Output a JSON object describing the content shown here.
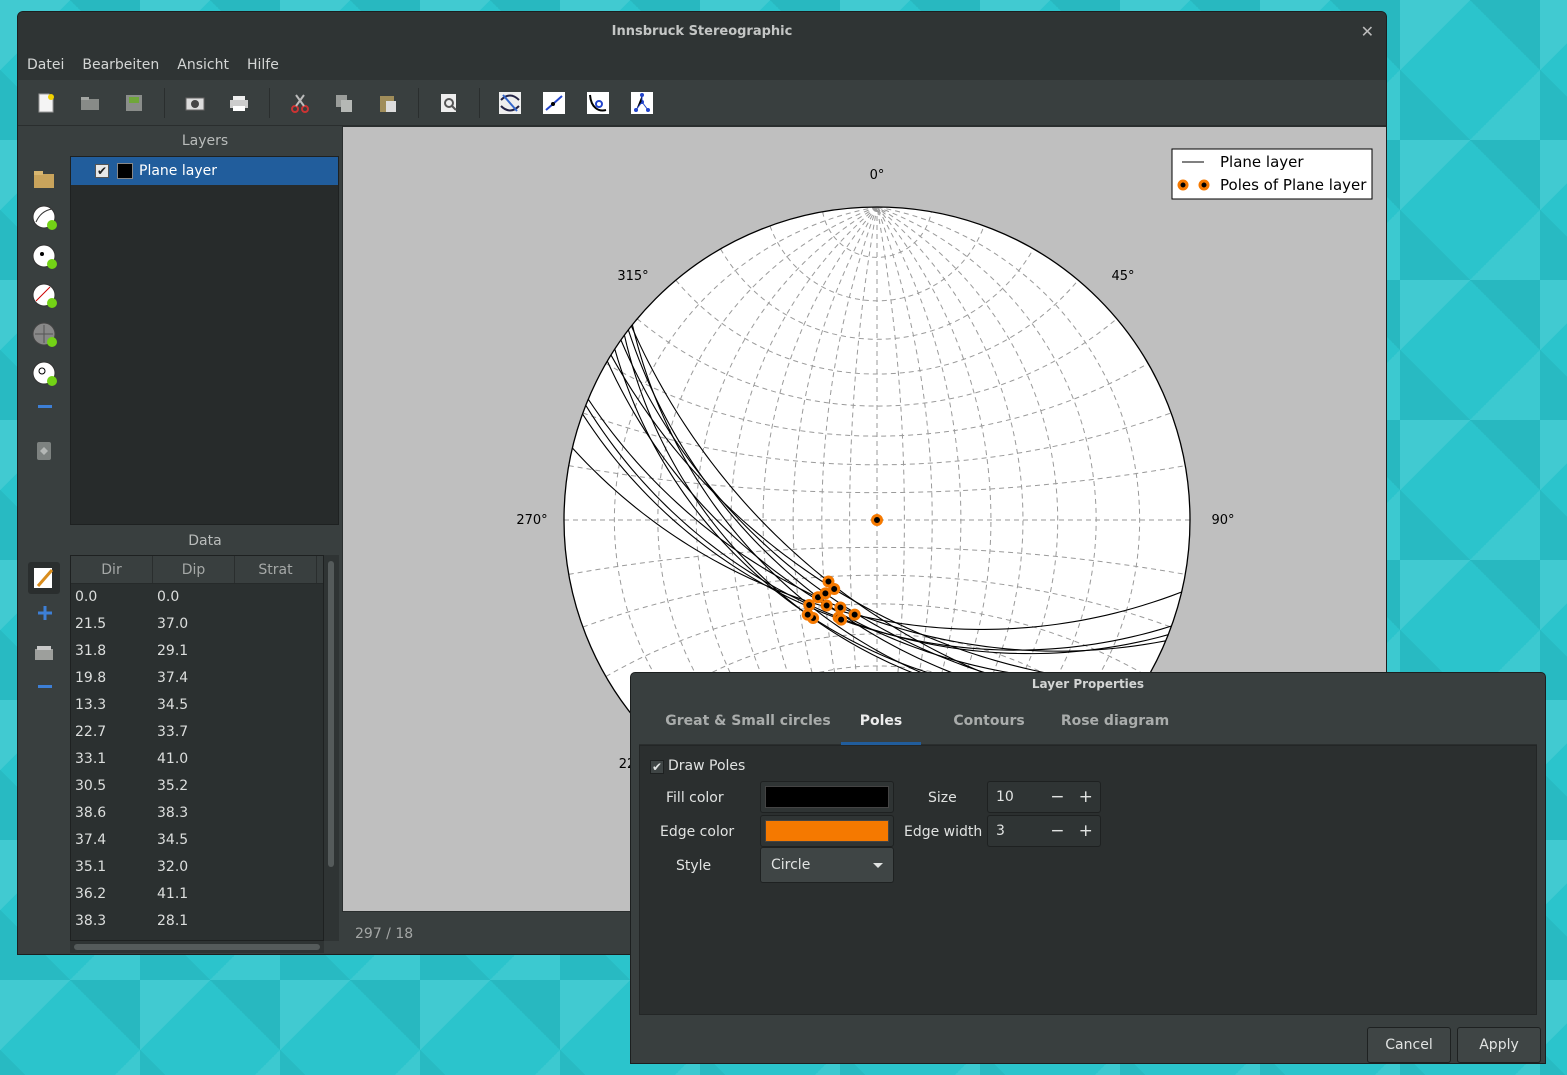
{
  "window": {
    "title": "Innsbruck Stereographic"
  },
  "menu": [
    "Datei",
    "Bearbeiten",
    "Ansicht",
    "Hilfe"
  ],
  "toolbar_icons": [
    "new-file",
    "open",
    "save",
    "screenshot",
    "print",
    "cut",
    "copy",
    "paste",
    "zoom",
    "great-circle",
    "line",
    "small-circle",
    "pole"
  ],
  "panels": {
    "layers_title": "Layers",
    "data_title": "Data"
  },
  "layers": [
    {
      "name": "Plane layer",
      "checked": true,
      "color": "#000000"
    }
  ],
  "data_table": {
    "headers": [
      "Dir",
      "Dip",
      "Strat"
    ],
    "rows": [
      [
        "0.0",
        "0.0",
        ""
      ],
      [
        "21.5",
        "37.0",
        ""
      ],
      [
        "31.8",
        "29.1",
        ""
      ],
      [
        "19.8",
        "37.4",
        ""
      ],
      [
        "13.3",
        "34.5",
        ""
      ],
      [
        "22.7",
        "33.7",
        ""
      ],
      [
        "33.1",
        "41.0",
        ""
      ],
      [
        "30.5",
        "35.2",
        ""
      ],
      [
        "38.6",
        "38.3",
        ""
      ],
      [
        "37.4",
        "34.5",
        ""
      ],
      [
        "35.1",
        "32.0",
        ""
      ],
      [
        "36.2",
        "41.1",
        ""
      ],
      [
        "38.3",
        "28.1",
        ""
      ]
    ]
  },
  "plot": {
    "angles": {
      "n": "0°",
      "ne": "45°",
      "e": "90°",
      "w": "270°",
      "nw": "315°",
      "sw": "22"
    },
    "legend": {
      "plane": "Plane layer",
      "poles": "Poles of Plane layer"
    },
    "plane_color": "#000000",
    "pole_fill": "#000000",
    "pole_edge": "#f57900",
    "poles": [
      [
        0,
        0
      ],
      [
        21.5,
        37.0
      ],
      [
        31.8,
        29.1
      ],
      [
        19.8,
        37.4
      ],
      [
        13.3,
        34.5
      ],
      [
        22.7,
        33.7
      ],
      [
        33.1,
        41.0
      ],
      [
        30.5,
        35.2
      ],
      [
        38.6,
        38.3
      ],
      [
        37.4,
        34.5
      ],
      [
        35.1,
        32.0
      ],
      [
        36.2,
        41.1
      ],
      [
        38.3,
        28.1
      ]
    ]
  },
  "status": "297 / 18",
  "dialog": {
    "title": "Layer Properties",
    "tabs": [
      "Great & Small circles",
      "Poles",
      "Contours",
      "Rose diagram"
    ],
    "active_tab": "Poles",
    "draw_poles_label": "Draw Poles",
    "draw_poles_checked": true,
    "fill_color_label": "Fill color",
    "fill_color": "#000000",
    "edge_color_label": "Edge color",
    "edge_color": "#f57900",
    "style_label": "Style",
    "style_value": "Circle",
    "size_label": "Size",
    "size_value": "10",
    "edge_width_label": "Edge width",
    "edge_width_value": "3",
    "cancel": "Cancel",
    "apply": "Apply"
  }
}
